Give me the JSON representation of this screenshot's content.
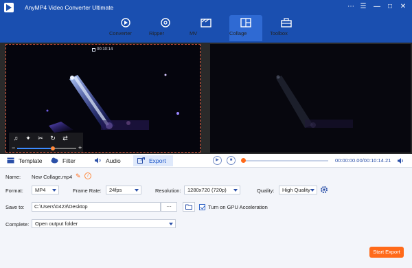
{
  "app": {
    "title": "AnyMP4 Video Converter Ultimate",
    "window_controls": [
      "⋯",
      "☰",
      "—",
      "□",
      "✕"
    ]
  },
  "nav": {
    "tabs": [
      {
        "label": "Converter",
        "icon": "converter-icon"
      },
      {
        "label": "Ripper",
        "icon": "ripper-icon"
      },
      {
        "label": "MV",
        "icon": "mv-icon"
      },
      {
        "label": "Collage",
        "icon": "collage-icon"
      },
      {
        "label": "Toolbox",
        "icon": "toolbox-icon"
      }
    ],
    "active": "Collage"
  },
  "preview": {
    "timecode": "00:10:14",
    "volume_level": 0.6
  },
  "tabs": {
    "items": [
      {
        "label": "Template",
        "icon": "template-icon"
      },
      {
        "label": "Filter",
        "icon": "filter-icon"
      },
      {
        "label": "Audio",
        "icon": "audio-icon"
      },
      {
        "label": "Export",
        "icon": "export-icon"
      }
    ],
    "active": "Export"
  },
  "playback": {
    "time": "00:00:00.00/00:10:14.21",
    "progress": 0.0
  },
  "export": {
    "name_label": "Name:",
    "name_value": "New Collage.mp4",
    "format_label": "Format:",
    "format_value": "MP4",
    "frame_rate_label": "Frame Rate:",
    "frame_rate_value": "24fps",
    "resolution_label": "Resolution:",
    "resolution_value": "1280x720 (720p)",
    "quality_label": "Quality:",
    "quality_value": "High Quality",
    "save_to_label": "Save to:",
    "save_to_value": "C:\\Users\\0423\\Desktop",
    "browse_label": "···",
    "gpu_label": "Turn on GPU Acceleration",
    "gpu_checked": true,
    "complete_label": "Complete:",
    "complete_value": "Open output folder",
    "start_export_label": "Start Export"
  },
  "colors": {
    "topbar": "#1a4fb0",
    "accent": "#ff6a1a",
    "link_blue": "#2b50a8"
  }
}
